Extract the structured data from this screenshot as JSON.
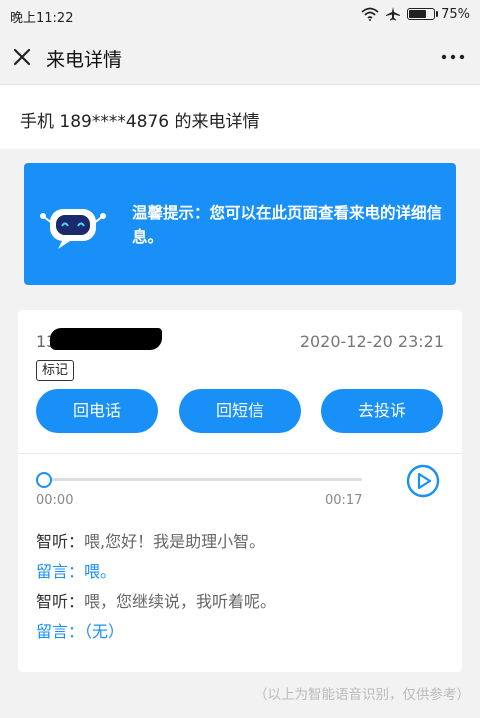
{
  "status_bar": {
    "time": "晚上11:22",
    "battery": "75%",
    "battery_level": 0.75
  },
  "header": {
    "title": "来电详情"
  },
  "subtitle": "手机 189****4876 的来电详情",
  "tip": {
    "text": "温馨提示：您可以在此页面查看来电的详细信息。"
  },
  "card": {
    "phone_prefix": "13",
    "datetime": "2020-12-20 23:21",
    "tag": "标记",
    "buttons": {
      "call_back": "回电话",
      "sms_back": "回短信",
      "complain": "去投诉"
    },
    "audio": {
      "current": "00:00",
      "duration": "00:17",
      "progress": 0
    },
    "transcript": [
      {
        "speaker": "智听：",
        "text": "喂,您好！我是助理小智。",
        "role": "assistant"
      },
      {
        "speaker": "留言：",
        "text": "喂。",
        "role": "caller"
      },
      {
        "speaker": "智听：",
        "text": "喂，您继续说，我听着呢。",
        "role": "assistant"
      },
      {
        "speaker": "留言：",
        "text": "（无）",
        "role": "caller"
      }
    ]
  },
  "footer": "（以上为智能语音识别，仅供参考）",
  "colors": {
    "accent": "#1890f7",
    "background": "#f2f2f2"
  },
  "icons": [
    "wifi-icon",
    "airplane-icon",
    "battery-icon",
    "close-icon",
    "more-icon",
    "robot-icon",
    "play-icon"
  ]
}
